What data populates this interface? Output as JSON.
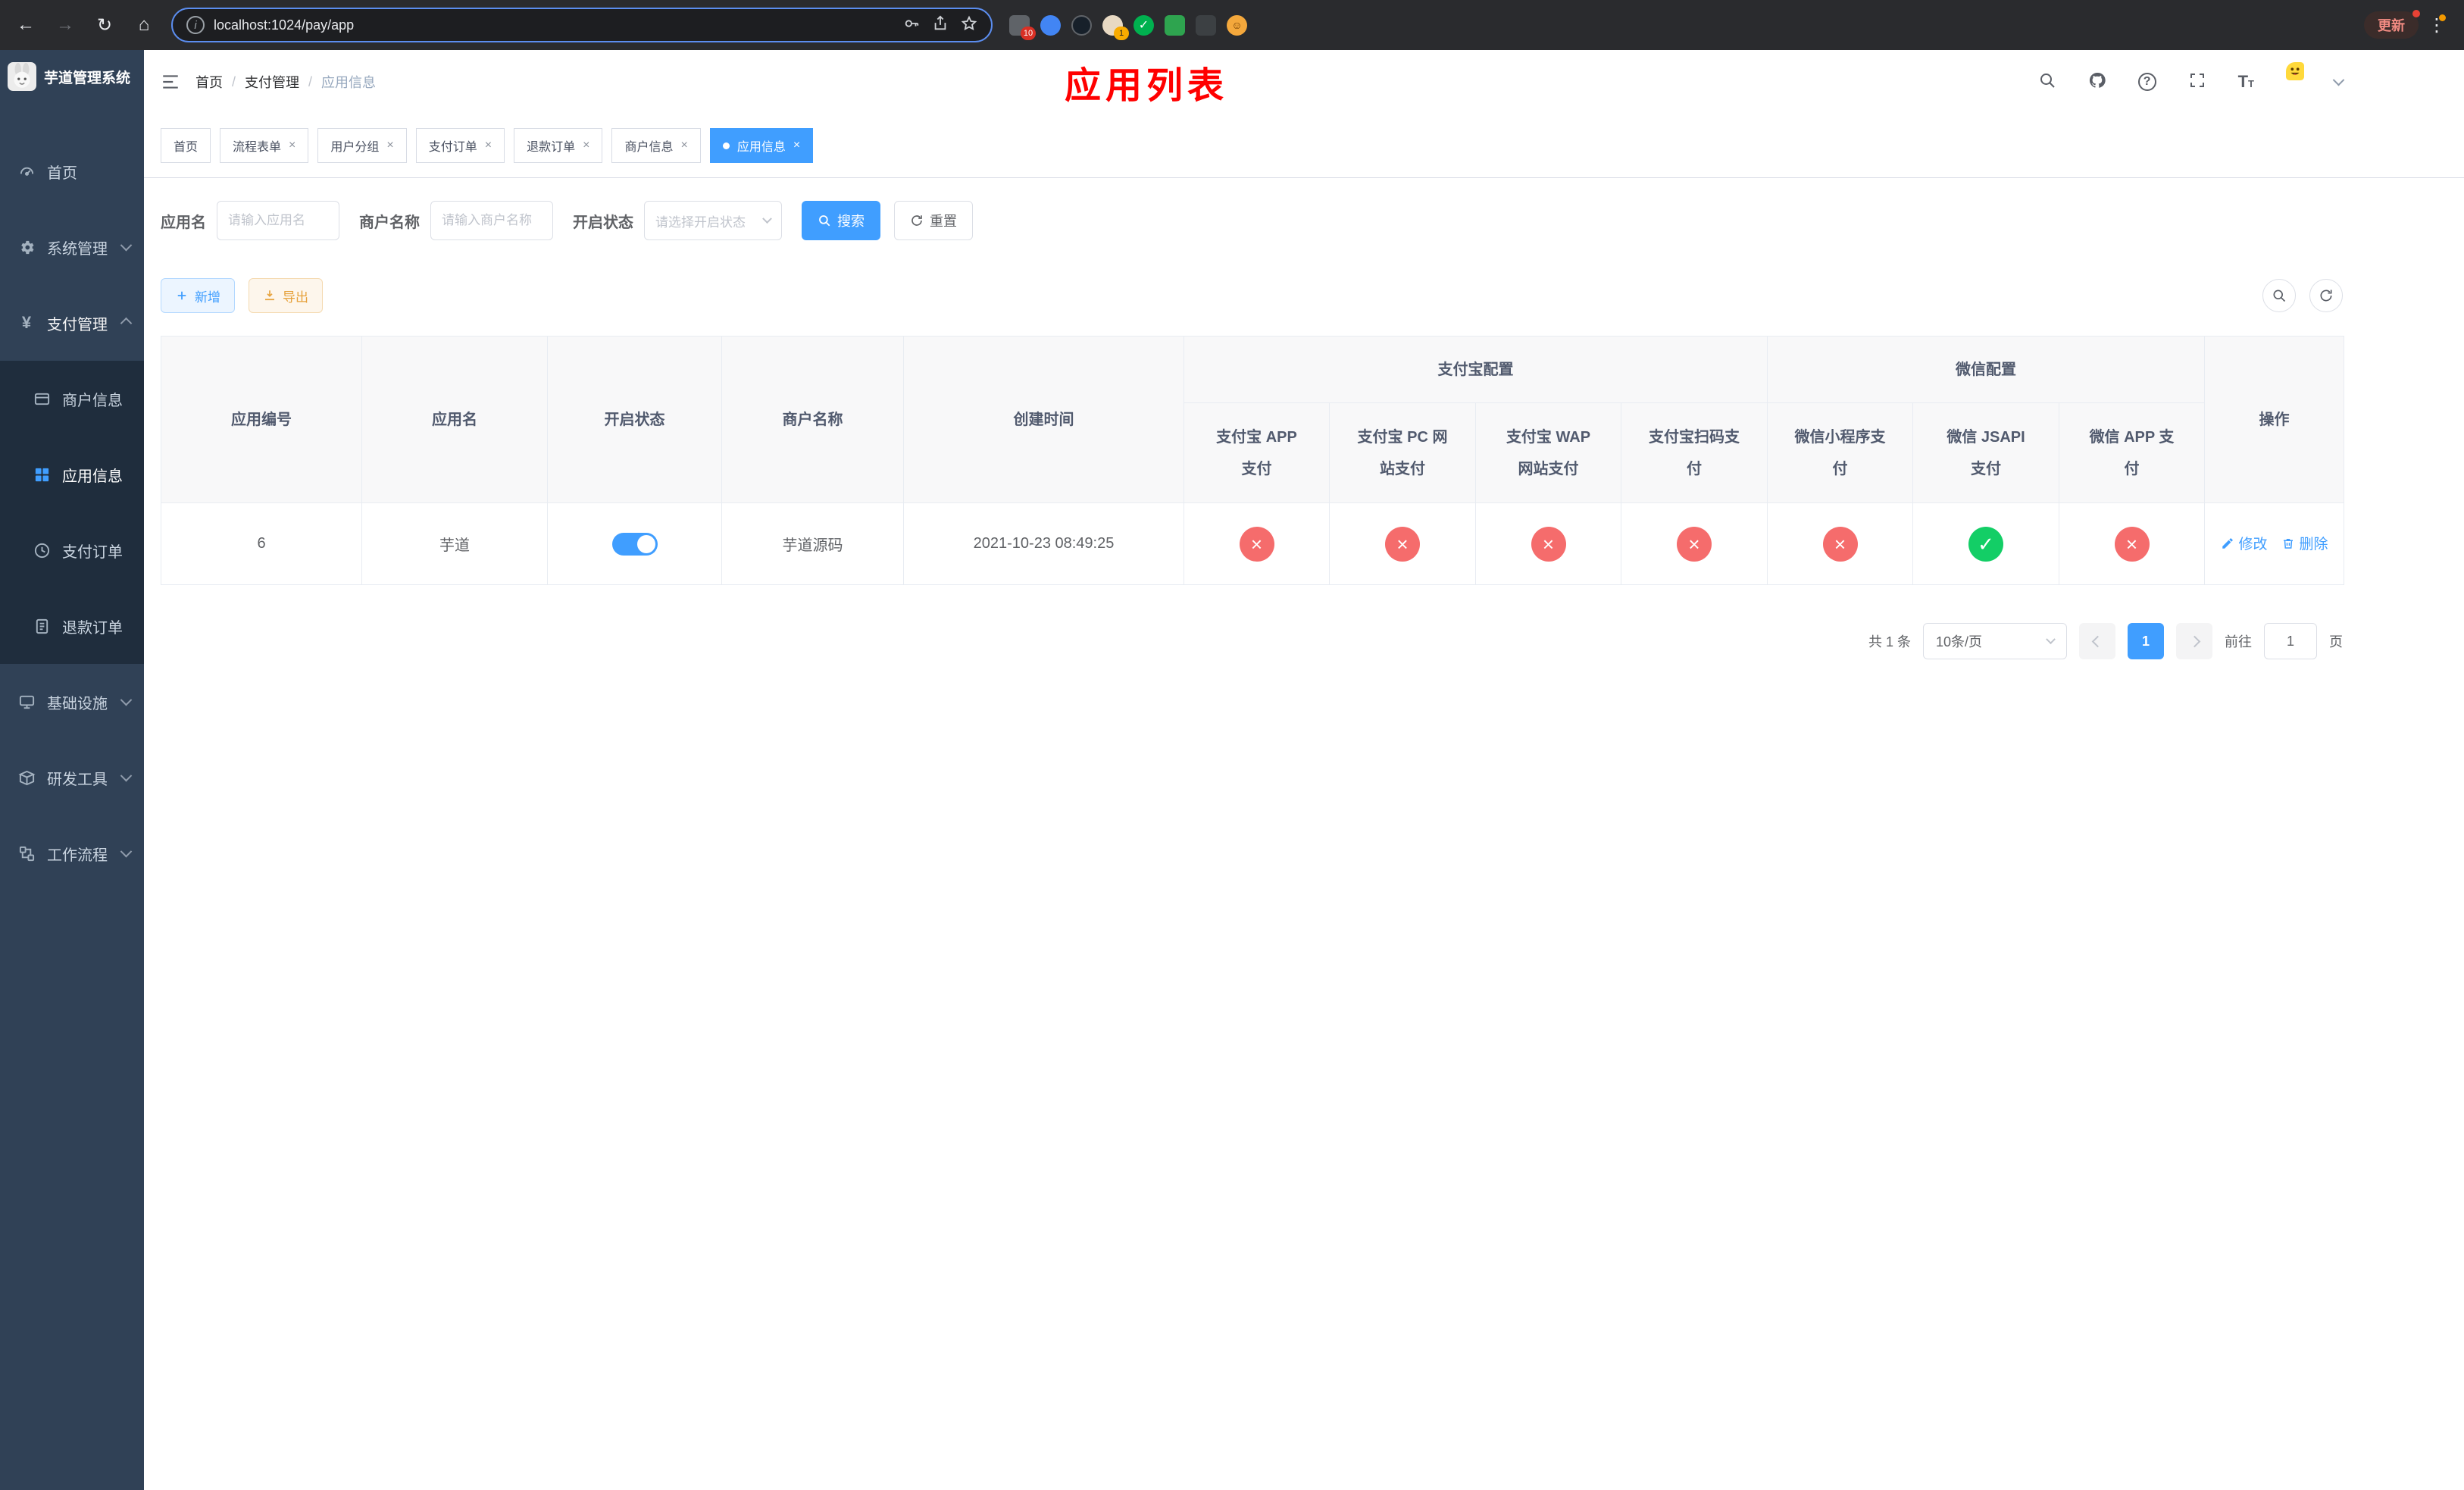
{
  "browser": {
    "url": "localhost:1024/pay/app",
    "update_button": "更新",
    "extension_badge_count": "10",
    "profile_badge_count": "1"
  },
  "header": {
    "breadcrumb": [
      "首页",
      "支付管理",
      "应用信息"
    ],
    "overlay_title": "应用列表"
  },
  "sidebar": {
    "logo_title": "芋道管理系统",
    "menu": [
      {
        "label": "首页"
      },
      {
        "label": "系统管理"
      },
      {
        "label": "支付管理"
      },
      {
        "label": "商户信息"
      },
      {
        "label": "应用信息"
      },
      {
        "label": "支付订单"
      },
      {
        "label": "退款订单"
      },
      {
        "label": "基础设施"
      },
      {
        "label": "研发工具"
      },
      {
        "label": "工作流程"
      }
    ]
  },
  "tabs": [
    {
      "label": "首页"
    },
    {
      "label": "流程表单"
    },
    {
      "label": "用户分组"
    },
    {
      "label": "支付订单"
    },
    {
      "label": "退款订单"
    },
    {
      "label": "商户信息"
    },
    {
      "label": "应用信息"
    }
  ],
  "filters": {
    "app_name_label": "应用名",
    "app_name_placeholder": "请输入应用名",
    "merchant_label": "商户名称",
    "merchant_placeholder": "请输入商户名称",
    "status_label": "开启状态",
    "status_placeholder": "请选择开启状态",
    "search_button": "搜索",
    "reset_button": "重置"
  },
  "toolbar": {
    "add_button": "新增",
    "export_button": "导出"
  },
  "table": {
    "headers": {
      "app_id": "应用编号",
      "app_name": "应用名",
      "status": "开启状态",
      "merchant": "商户名称",
      "created_at": "创建时间",
      "alipay_group": "支付宝配置",
      "wechat_group": "微信配置",
      "alipay_app": "支付宝 APP 支付",
      "alipay_pc": "支付宝 PC 网站支付",
      "alipay_wap": "支付宝 WAP 网站支付",
      "alipay_qr": "支付宝扫码支付",
      "wechat_lite": "微信小程序支付",
      "wechat_jsapi": "微信 JSAPI 支付",
      "wechat_app": "微信 APP 支付",
      "actions": "操作"
    },
    "rows": [
      {
        "app_id": "6",
        "app_name": "芋道",
        "status_enabled": true,
        "merchant": "芋道源码",
        "created_at": "2021-10-23 08:49:25",
        "configs": {
          "alipay_app": false,
          "alipay_pc": false,
          "alipay_wap": false,
          "alipay_qr": false,
          "wechat_lite": false,
          "wechat_jsapi": true,
          "wechat_app": false
        },
        "edit_label": "修改",
        "delete_label": "删除"
      }
    ]
  },
  "pagination": {
    "total_text": "共 1 条",
    "page_size": "10条/页",
    "current_page": "1",
    "goto_label": "前往",
    "goto_value": "1",
    "page_unit": "页"
  },
  "colors": {
    "primary": "#409eff",
    "danger": "#f56c6c",
    "success": "#13ce66",
    "sidebar_bg": "#304156",
    "submenu_bg": "#1f2d3d",
    "overlay_red": "#ff0000"
  }
}
